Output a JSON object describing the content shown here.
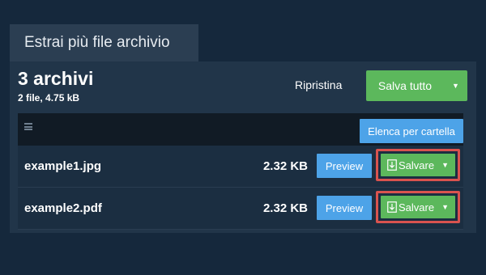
{
  "tab": {
    "title": "Estrai più file archivio"
  },
  "summary": {
    "title": "3 archivi",
    "subtitle": "2 file, 4.75 kB"
  },
  "actions": {
    "reset_label": "Ripristina",
    "save_all_label": "Salva tutto"
  },
  "list": {
    "by_folder_label": "Elenca per cartella",
    "files": [
      {
        "name": "example1.jpg",
        "size": "2.32 KB",
        "preview_label": "Preview",
        "save_label": "Salvare"
      },
      {
        "name": "example2.pdf",
        "size": "2.32 KB",
        "preview_label": "Preview",
        "save_label": "Salvare"
      }
    ]
  },
  "colors": {
    "background": "#15283c",
    "panel": "#213549",
    "accent_green": "#5cb85c",
    "accent_blue": "#4da3e8",
    "highlight_red": "#d9534f"
  },
  "icons": [
    "menu-icon",
    "caret-down-icon",
    "download-icon"
  ]
}
